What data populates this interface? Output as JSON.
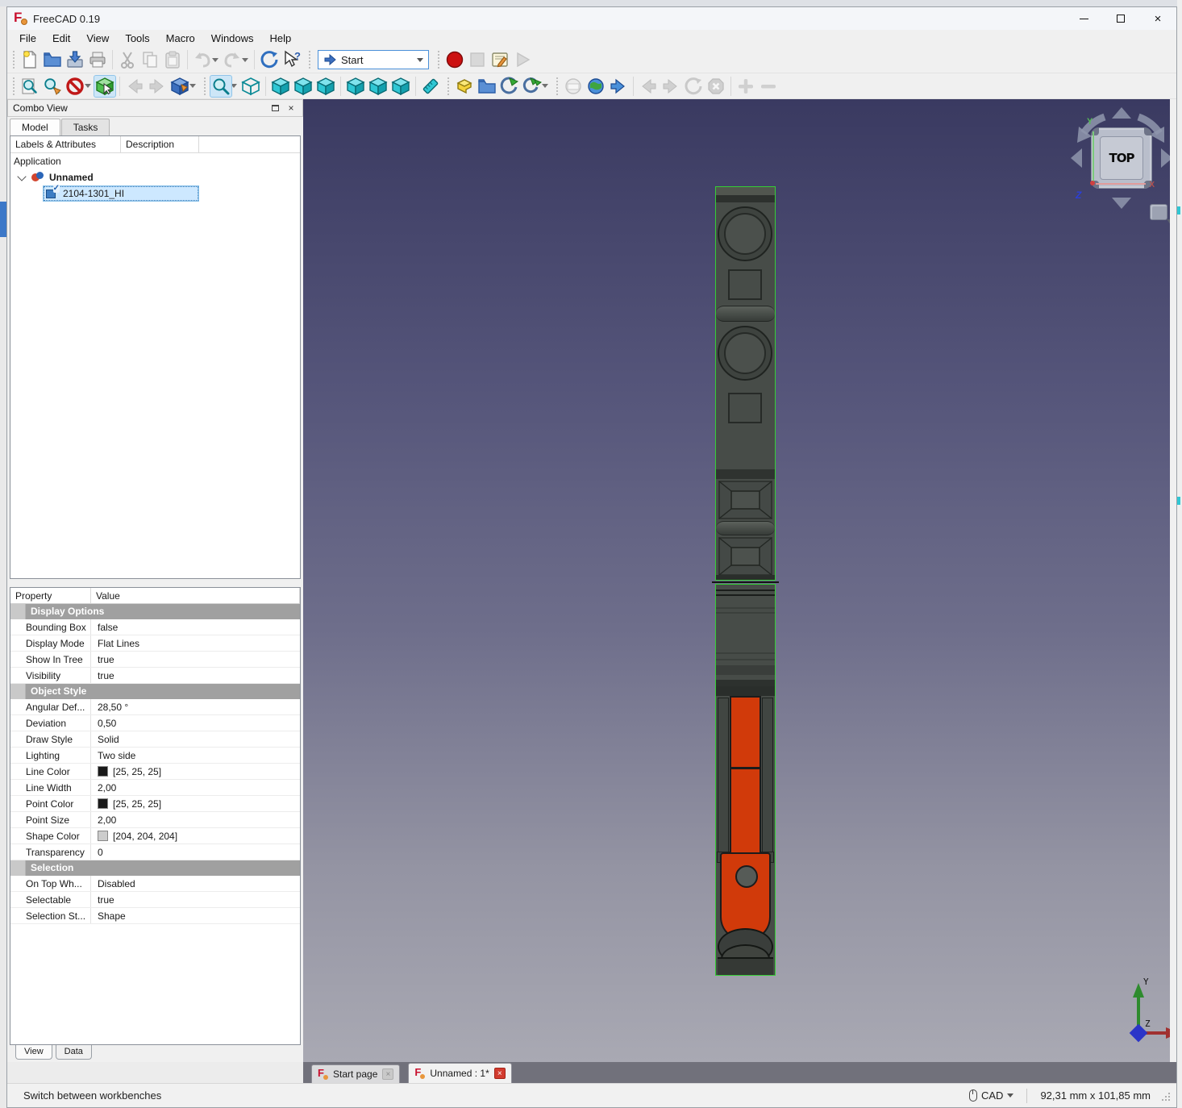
{
  "window": {
    "title": "FreeCAD 0.19"
  },
  "menus": [
    "File",
    "Edit",
    "View",
    "Tools",
    "Macro",
    "Windows",
    "Help"
  ],
  "toolbar": {
    "workbench_selector": "Start",
    "row1_icons": [
      "new-document",
      "open-file",
      "save",
      "print",
      "cut",
      "copy",
      "paste",
      "undo",
      "redo",
      "refresh",
      "whats-this",
      "workbench-selector",
      "macro-record",
      "macro-stop",
      "macro-edit",
      "macro-play"
    ],
    "row2_icons": [
      "fit-all",
      "fit-selection",
      "draw-style",
      "edit-mode",
      "nav-back",
      "nav-forward",
      "isometric-view",
      "zoom-tool",
      "axonometric-view",
      "view-front",
      "view-top",
      "view-right",
      "view-rear",
      "view-bottom",
      "view-left",
      "measure-distance",
      "create-part",
      "create-group",
      "make-link",
      "make-external-link",
      "web-page",
      "open-website",
      "browser-go",
      "browser-back",
      "browser-forward",
      "browser-refresh",
      "browser-stop",
      "zoom-in",
      "zoom-out"
    ]
  },
  "combo_view": {
    "title": "Combo View",
    "tabs": [
      "Model",
      "Tasks"
    ],
    "tree": {
      "columns": [
        "Labels & Attributes",
        "Description"
      ],
      "root": "Application",
      "document": "Unnamed",
      "item": "2104-1301_HI"
    },
    "properties": {
      "columns": [
        "Property",
        "Value"
      ],
      "rows": [
        {
          "type": "group",
          "label": "Display Options"
        },
        {
          "label": "Bounding Box",
          "value": "false"
        },
        {
          "label": "Display Mode",
          "value": "Flat Lines"
        },
        {
          "label": "Show In Tree",
          "value": "true"
        },
        {
          "label": "Visibility",
          "value": "true"
        },
        {
          "type": "group",
          "label": "Object Style"
        },
        {
          "label": "Angular Def...",
          "value": "28,50 °"
        },
        {
          "label": "Deviation",
          "value": "0,50"
        },
        {
          "label": "Draw Style",
          "value": "Solid"
        },
        {
          "label": "Lighting",
          "value": "Two side"
        },
        {
          "label": "Line Color",
          "value": "[25, 25, 25]",
          "swatch": "#191919"
        },
        {
          "label": "Line Width",
          "value": "2,00"
        },
        {
          "label": "Point Color",
          "value": "[25, 25, 25]",
          "swatch": "#191919"
        },
        {
          "label": "Point Size",
          "value": "2,00"
        },
        {
          "label": "Shape Color",
          "value": "[204, 204, 204]",
          "swatch": "#CCCCCC"
        },
        {
          "label": "Transparency",
          "value": "0"
        },
        {
          "type": "group",
          "label": "Selection"
        },
        {
          "label": "On Top Wh...",
          "value": "Disabled"
        },
        {
          "label": "Selectable",
          "value": "true"
        },
        {
          "label": "Selection St...",
          "value": "Shape"
        }
      ]
    },
    "bottom_tabs": [
      "View",
      "Data"
    ]
  },
  "viewport": {
    "nav_cube_label": "TOP",
    "axes": {
      "x": "X",
      "y": "Y",
      "z": "Z"
    },
    "colors": {
      "bg_top": "#3A3A61",
      "bg_bottom": "#A9A9B3",
      "selection_outline": "#35CE35",
      "part_gray": "#474C48",
      "part_orange": "#D13A0A"
    }
  },
  "mdi_tabs": [
    {
      "label": "Start page"
    },
    {
      "label": "Unnamed : 1*"
    }
  ],
  "status_bar": {
    "message": "Switch between workbenches",
    "nav_style": "CAD",
    "dimensions": "92,31 mm x 101,85 mm"
  }
}
